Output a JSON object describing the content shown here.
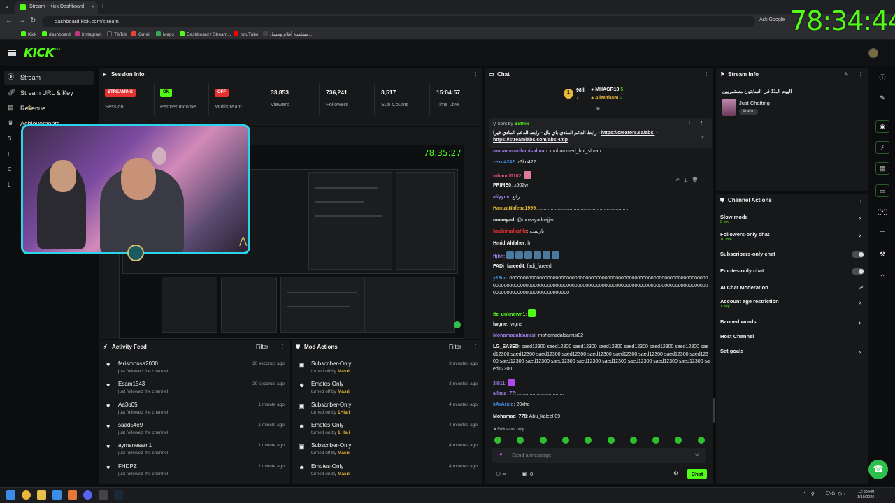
{
  "browser": {
    "tab_title": "Stream - Kick Dashboard",
    "url": "dashboard.kick.com/stream",
    "ask_google": "Ask Google",
    "bookmarks": [
      "Kick",
      "dashboard",
      "instagram",
      "TikTok",
      "Gmail",
      "Maps",
      "Dashboard / Stream...",
      "YouTube",
      "مشاهدة أفلام ومسل..."
    ],
    "overlay_clock": "78:34:44"
  },
  "header": {
    "logo": "KICK",
    "beta": "BETA"
  },
  "sidebar": {
    "items": [
      {
        "label": "Stream",
        "icon": "stream-icon"
      },
      {
        "label": "Stream URL & Key",
        "icon": "link-icon"
      },
      {
        "label": "Revenue",
        "icon": "revenue-icon"
      },
      {
        "label": "Achievements",
        "icon": "trophy-icon"
      }
    ],
    "partial": [
      "S",
      "I",
      "C",
      "L"
    ]
  },
  "session": {
    "title": "Session Info",
    "cells": [
      {
        "badge": "STREAMING",
        "label": "Session",
        "color": "#e5312f"
      },
      {
        "badge": "ON",
        "label": "Partner Income",
        "color": "#53fc18"
      },
      {
        "badge": "OFF",
        "label": "Multistream",
        "color": "#e5312f"
      },
      {
        "value": "33,853",
        "label": "Viewers"
      },
      {
        "value": "736,241",
        "label": "Followers"
      },
      {
        "value": "3,517",
        "label": "Sub Counts"
      },
      {
        "value": "15:04:57",
        "label": "Time Live"
      }
    ]
  },
  "preview": {
    "time": "78:35:27"
  },
  "activity": {
    "title": "Activity Feed",
    "filter": "Filter",
    "items": [
      {
        "name": "farismousa2000",
        "sub": "just followed the channel",
        "time": "20 seconds ago"
      },
      {
        "name": "Esam1543",
        "sub": "just followed the channel",
        "time": "20 seconds ago"
      },
      {
        "name": "Aa3o05",
        "sub": "just followed the channel",
        "time": "1 minute ago"
      },
      {
        "name": "saad54e9",
        "sub": "just followed the channel",
        "time": "1 minute ago"
      },
      {
        "name": "aymanesam1",
        "sub": "just followed the channel",
        "time": "1 minute ago"
      },
      {
        "name": "FHDPZ",
        "sub": "just followed the channel",
        "time": "1 minute ago"
      }
    ]
  },
  "mod": {
    "title": "Mod Actions",
    "filter": "Filter",
    "items": [
      {
        "name": "Subscriber-Only",
        "prefix": "turned off by",
        "by": "Masri",
        "time": "3 minutes ago",
        "icon": "gift-icon"
      },
      {
        "name": "Emotes-Only",
        "prefix": "turned off by",
        "by": "Masri",
        "time": "3 minutes ago",
        "icon": "smile-icon"
      },
      {
        "name": "Subscriber-Only",
        "prefix": "turned on by",
        "by": "1Hlali",
        "time": "4 minutes ago",
        "icon": "gift-icon"
      },
      {
        "name": "Emotes-Only",
        "prefix": "turned on by",
        "by": "1Hlali",
        "time": "4 minutes ago",
        "icon": "smile-icon"
      },
      {
        "name": "Subscriber-Only",
        "prefix": "turned off by",
        "by": "Masri",
        "time": "4 minutes ago",
        "icon": "gift-icon"
      },
      {
        "name": "Emotes-Only",
        "prefix": "turned on by",
        "by": "Masri",
        "time": "4 minutes ago",
        "icon": "smile-icon"
      }
    ]
  },
  "chat": {
    "title": "Chat",
    "leaders": [
      {
        "rank": "1",
        "name": "98ll",
        "name2": "MHAGR10",
        "count2": "5"
      },
      {
        "rank": "",
        "name": "7",
        "name2": "AliMitham",
        "count2": "2"
      }
    ],
    "pinned": {
      "sent_by": "Sent by",
      "bot": "BotRix",
      "text": "رابط الدعم المادي باي بال - رابط الدعم المادي فيزا - ",
      "link1": "https://creators.sa/absi",
      "link2": "https://streamlabs.com/absi4/tip"
    },
    "messages": [
      {
        "user": "mohammadbanisalman",
        "text": "mohammed_bni_slman",
        "color": "#a07ee8"
      },
      {
        "user": "zeko4242",
        "text": "z3ko422",
        "color": "#4a90e2"
      },
      {
        "user": "mhamd0102",
        "text": "",
        "color": "#e0507a"
      },
      {
        "user": "PRIME0",
        "text": "x602w",
        "color": "#f0f0f0"
      },
      {
        "user": "aliyycv",
        "text": "رائع",
        "color": "#a07ee8"
      },
      {
        "user": "HamzaNafeaa1999",
        "text": "..................................................................",
        "color": "#e6b93a"
      },
      {
        "user": "moaayad",
        "text": "@moaayadnajjar",
        "color": "#f0f0f0"
      },
      {
        "user": "hashimalkahlo",
        "text": "ياريييب",
        "color": "#e5312f"
      },
      {
        "user": "HmidiAldaher",
        "text": "h",
        "color": "#f0f0f0"
      },
      {
        "user": "ffjhh",
        "text": "",
        "color": "#a07ee8"
      },
      {
        "user": "FADi_fareed4",
        "text": "fadi_fareed",
        "color": "#f0f0f0"
      },
      {
        "user": "y13ca",
        "text": "000000000000000000000000000000000000000000000000000000000000000000000000000000000000000000000000000000000000000000000000000000000000000000000000000000000000000000000000000000000000",
        "color": "#4a90e2"
      },
      {
        "user": "itz_unknown1",
        "text": "",
        "color": "#53fc18"
      },
      {
        "user": "lwgne",
        "text": "lwgne",
        "color": "#f0f0f0"
      },
      {
        "user": "Mohamadaldamisi",
        "text": "mohamadaldamisi02",
        "color": "#a07ee8"
      },
      {
        "user": "LG_SA3ED",
        "text": "saed12300 saed12300 saed12300 saed12300 saed12300 saed12300 saed12300 saed12300 saed12300 saed12300 saed12300 saed12300 saed12300 saed12300 saed12300 saed12300 saed12300 saed12300 saed12300 saed12300 saed12300 saed12300 saed12300 saed12300 saed12300",
        "color": "#f0f0f0"
      },
      {
        "user": "3l911",
        "text": "",
        "color": "#a07ee8"
      },
      {
        "user": "allaaa_77",
        "text": "..................................",
        "color": "#a07ee8"
      },
      {
        "user": "kArArxiq",
        "text": "20xho",
        "color": "#4a90e2"
      },
      {
        "user": "Mohamad_778",
        "text": "Abu_kaleel.09",
        "color": "#f0f0f0"
      }
    ],
    "followers_only": "Followers only",
    "placeholder": "Send a message",
    "count": "0",
    "send": "Chat"
  },
  "stream_info": {
    "title": "Stream info",
    "stream_title": "اليوم الـ11 في السابتون مستمريين",
    "category": "Just Chatting",
    "language": "Arabic"
  },
  "channel_actions": {
    "title": "Channel Actions",
    "items": [
      {
        "label": "Slow mode",
        "sub": "5 sec",
        "control": "chevron"
      },
      {
        "label": "Followers-only chat",
        "sub": "10 min",
        "control": "chevron"
      },
      {
        "label": "Subscribers-only chat",
        "sub": "",
        "control": "toggle"
      },
      {
        "label": "Emotes-only chat",
        "sub": "",
        "control": "toggle"
      },
      {
        "label": "AI Chat Moderation",
        "sub": "",
        "control": "external"
      },
      {
        "label": "Account age restriction",
        "sub": "1 day",
        "control": "chevron"
      },
      {
        "label": "Banned words",
        "sub": "",
        "control": "chevron"
      },
      {
        "label": "Host Channel",
        "sub": "",
        "control": "none"
      },
      {
        "label": "Set goals",
        "sub": "",
        "control": "chevron"
      }
    ]
  },
  "taskbar": {
    "time": "12:38 PM",
    "date": "1/19/2026",
    "lang": "ENG"
  },
  "colors": {
    "accent": "#53fc18",
    "live": "#e5312f",
    "webcam_border": "#2bd4e8"
  }
}
